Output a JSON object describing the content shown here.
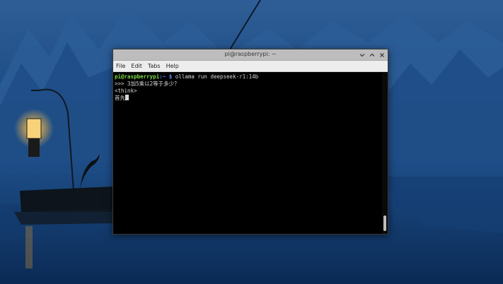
{
  "window": {
    "title": "pi@raspberrypi: ~",
    "minimize_icon": "chevron-down-icon",
    "maximize_icon": "chevron-up-icon",
    "close_icon": "close-icon"
  },
  "menubar": {
    "items": [
      {
        "label": "File"
      },
      {
        "label": "Edit"
      },
      {
        "label": "Tabs"
      },
      {
        "label": "Help"
      }
    ]
  },
  "terminal": {
    "line1": {
      "user_host": "pi@raspberrypi",
      "path": ":~ $",
      "command": " ollama run deepseek-r1:14b"
    },
    "line2": ">>> 3加5乘以2等于多少？",
    "line3": "<think>",
    "line4": "首先"
  },
  "colors": {
    "terminal_bg": "#000000",
    "prompt_user": "#7fd94a",
    "prompt_path": "#6f8cff",
    "titlebar_bg": "#bdbdbd",
    "menubar_bg": "#ededed"
  }
}
